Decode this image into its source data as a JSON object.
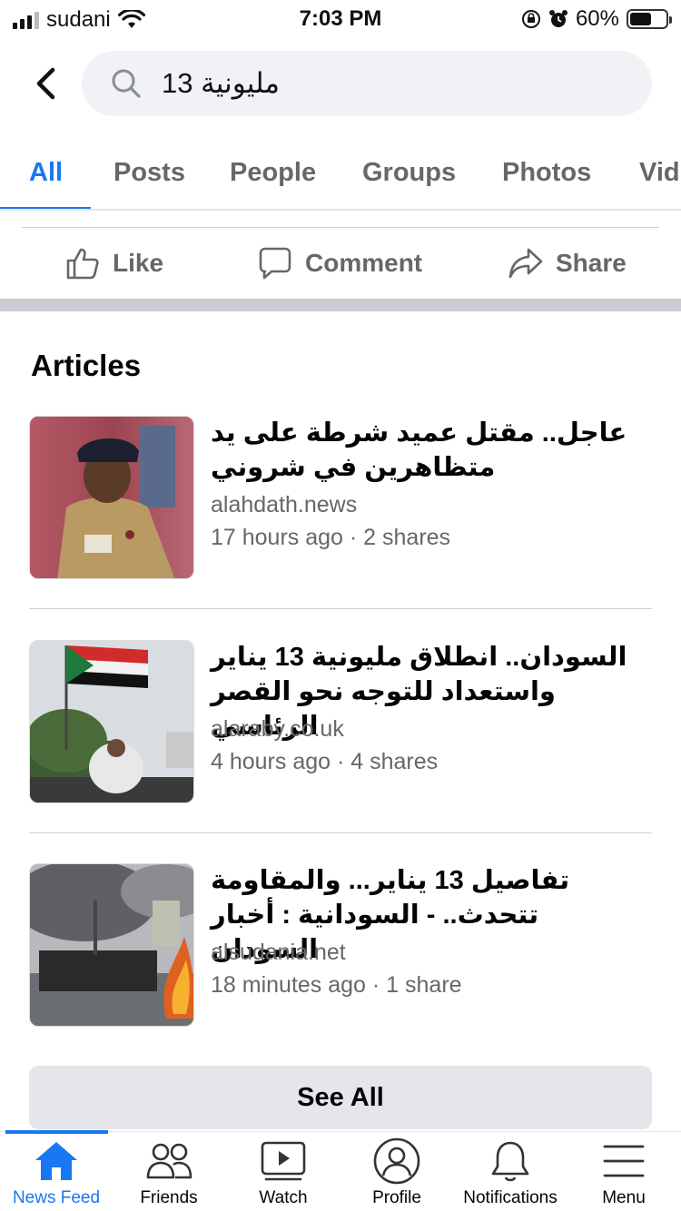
{
  "status_bar": {
    "carrier": "sudani",
    "time": "7:03 PM",
    "battery": "60%",
    "battery_level": 0.6
  },
  "search": {
    "query": "مليونية 13"
  },
  "tabs": [
    {
      "label": "All",
      "active": true
    },
    {
      "label": "Posts"
    },
    {
      "label": "People"
    },
    {
      "label": "Groups"
    },
    {
      "label": "Photos"
    },
    {
      "label": "Vid"
    }
  ],
  "actions": {
    "like": "Like",
    "comment": "Comment",
    "share": "Share"
  },
  "articles": {
    "heading": "Articles",
    "items": [
      {
        "title": "عاجل.. مقتل عميد شرطة على يد متظاهرين في شروني",
        "domain": "alahdath.news",
        "meta": "17 hours ago · 2 shares"
      },
      {
        "title": "السودان.. انطلاق مليونية 13 يناير واستعداد للتوجه نحو القصر الرئاسي",
        "domain": "alaraby.co.uk",
        "meta": "4 hours ago · 4 shares"
      },
      {
        "title": "تفاصيل 13 يناير... والمقاومة تتحدث.. - السودانية : أخبار السودان",
        "domain": "alsudania.net",
        "meta": "18 minutes ago · 1 share"
      }
    ],
    "see_all": "See All"
  },
  "bottom_nav": [
    {
      "label": "News Feed",
      "icon": "home-icon",
      "active": true
    },
    {
      "label": "Friends",
      "icon": "friends-icon"
    },
    {
      "label": "Watch",
      "icon": "watch-icon"
    },
    {
      "label": "Profile",
      "icon": "profile-icon"
    },
    {
      "label": "Notifications",
      "icon": "bell-icon"
    },
    {
      "label": "Menu",
      "icon": "menu-icon"
    }
  ],
  "colors": {
    "accent": "#1877f2",
    "secondary_text": "#65676b"
  }
}
